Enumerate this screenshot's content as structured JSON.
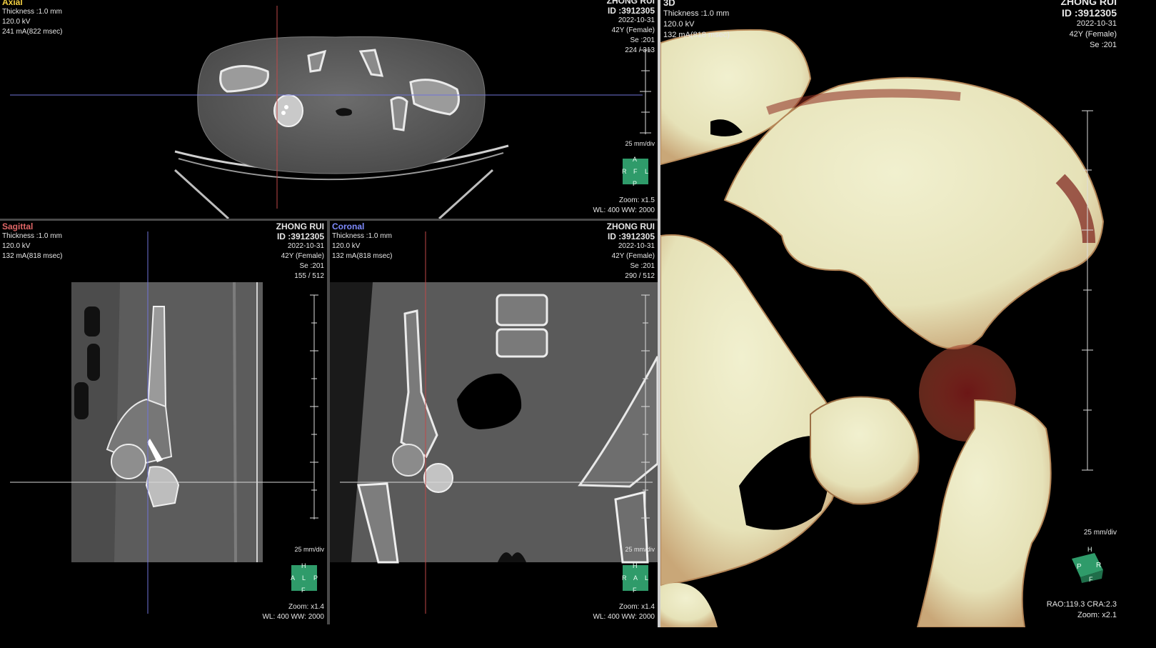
{
  "colors": {
    "axial": "#f5d142",
    "sagittal": "#e06666",
    "coronal": "#7f8cff",
    "three_d": "#f2f2f2",
    "cube": "#2f9b6a"
  },
  "axial": {
    "title": "Axial",
    "lines": [
      "Thickness :1.0 mm",
      "120.0 kV",
      "241 mA(822 msec)"
    ],
    "patient": "ZHONG RUI",
    "id": "ID :3912305",
    "date": "2022-10-31",
    "age_sex": "42Y (Female)",
    "series": "Se :201",
    "slice": "224 / 313",
    "scale": "25 mm/div",
    "zoom": "Zoom: x1.5",
    "window": "WL: 400  WW: 2000",
    "cube": {
      "top": "A",
      "left": "R",
      "center": "F",
      "right": "L",
      "bottom": "P"
    }
  },
  "sagittal": {
    "title": "Sagittal",
    "lines": [
      "Thickness :1.0 mm",
      "120.0 kV",
      "132 mA(818 msec)"
    ],
    "patient": "ZHONG RUI",
    "id": "ID :3912305",
    "date": "2022-10-31",
    "age_sex": "42Y (Female)",
    "series": "Se :201",
    "slice": "155 / 512",
    "scale": "25 mm/div",
    "zoom": "Zoom: x1.4",
    "window": "WL: 400  WW: 2000",
    "cube": {
      "top": "H",
      "left": "A",
      "center": "L",
      "right": "P",
      "bottom": "F"
    }
  },
  "coronal": {
    "title": "Coronal",
    "lines": [
      "Thickness :1.0 mm",
      "120.0 kV",
      "132 mA(818 msec)"
    ],
    "patient": "ZHONG RUI",
    "id": "ID :3912305",
    "date": "2022-10-31",
    "age_sex": "42Y (Female)",
    "series": "Se :201",
    "slice": "290 / 512",
    "scale": "25 mm/div",
    "zoom": "Zoom: x1.4",
    "window": "WL: 400  WW: 2000",
    "cube": {
      "top": "H",
      "left": "R",
      "center": "A",
      "right": "L",
      "bottom": "F"
    }
  },
  "three_d": {
    "title": "3D",
    "lines": [
      "Thickness :1.0 mm",
      "120.0 kV",
      "132 mA(818 msec)"
    ],
    "patient": "ZHONG RUI",
    "id": "ID :3912305",
    "date": "2022-10-31",
    "age_sex": "42Y (Female)",
    "series": "Se :201",
    "scale": "25 mm/div",
    "angles": "RAO:119.3 CRA:2.3",
    "zoom": "Zoom: x2.1",
    "cube": {
      "top": "H",
      "left": "P",
      "right": "R",
      "bottom": "F"
    }
  }
}
